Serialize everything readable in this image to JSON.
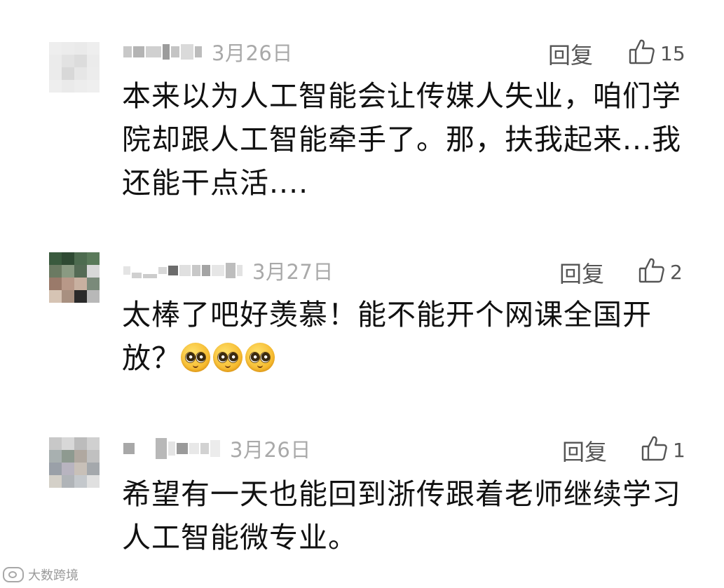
{
  "comments": [
    {
      "date": "3月26日",
      "reply_label": "回复",
      "like_count": "15",
      "text": "本来以为人工智能会让传媒人失业，咱们学院却跟人工智能牵手了。那，扶我起来...我还能干点活....",
      "avatar_colors": [
        "#eeeeee",
        "#ececec",
        "#eaeaea",
        "#eeeeee",
        "#ebebeb",
        "#e2e2e2",
        "#dcdcdc",
        "#ebebeb",
        "#ebebeb",
        "#d8d8d8",
        "#e6e6e6",
        "#ececec",
        "#eeeeee",
        "#eaeaea",
        "#ededed",
        "#efefef"
      ]
    },
    {
      "date": "3月27日",
      "reply_label": "回复",
      "like_count": "2",
      "text": "太棒了吧好羡慕！能不能开个网课全国开放？",
      "emoji": "pleading-face",
      "emoji_count": 3,
      "avatar_colors": [
        "#3a5a3e",
        "#2f4a33",
        "#4d6b4f",
        "#5a7a5a",
        "#6b7a62",
        "#8a9a82",
        "#556b55",
        "#d8d8d8",
        "#9a7a6a",
        "#b89888",
        "#c8b0a0",
        "#7a8a7a",
        "#d6c4b4",
        "#a89080",
        "#2a2a2a",
        "#b8b8b8"
      ]
    },
    {
      "date": "3月26日",
      "reply_label": "回复",
      "like_count": "1",
      "text": "希望有一天也能回到浙传跟着老师继续学习人工智能微专业。",
      "avatar_colors": [
        "#c8c8c8",
        "#d8d8d8",
        "#bcbcbc",
        "#d0d0d0",
        "#a8b0b0",
        "#8e9a90",
        "#b0a8a0",
        "#c0c0c0",
        "#9aa0a8",
        "#b8b4c0",
        "#c8c0b8",
        "#a4a8ac",
        "#d4d0c8",
        "#b0b4b8",
        "#c4c8cc",
        "#e0e0e0"
      ]
    }
  ],
  "watermark": {
    "text": "大数跨境",
    "icon": "camera-logo-icon"
  },
  "colors": {
    "meta_gray": "#a9a9a9",
    "action_gray": "#555555",
    "text": "#111111"
  }
}
